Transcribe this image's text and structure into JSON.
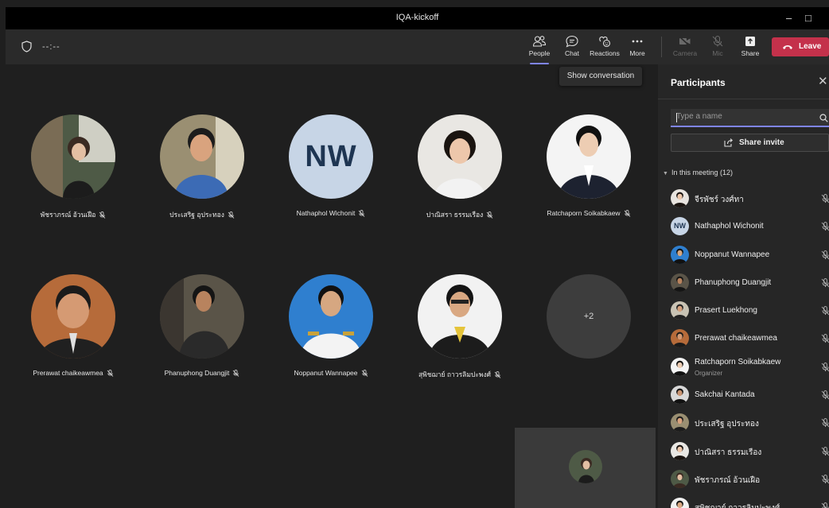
{
  "window": {
    "title": "IQA-kickoff",
    "minimize": "–",
    "maximize": "□"
  },
  "toolbar": {
    "timer": "--:--",
    "buttons": {
      "people": "People",
      "chat": "Chat",
      "reactions": "Reactions",
      "more": "More",
      "camera": "Camera",
      "mic": "Mic",
      "share": "Share",
      "leave": "Leave"
    }
  },
  "tooltip": "Show conversation",
  "stage": {
    "tiles": [
      {
        "name": "พัชราภรณ์ อ้วนเฝือ"
      },
      {
        "name": "ประเสริฐ อุประทอง"
      },
      {
        "name": "Nathaphol Wichonit",
        "initials": "NW"
      },
      {
        "name": "ปาณิสรา ธรรมเรือง"
      },
      {
        "name": "Ratchaporn Soikabkaew"
      },
      {
        "name": "Prerawat chaikeawmea"
      },
      {
        "name": "Phanuphong Duangjit"
      },
      {
        "name": "Noppanut Wannapee"
      },
      {
        "name": "สุพิชฌาย์ ถาวรลิมปะพงศ์"
      },
      {
        "overflow": "+2"
      }
    ]
  },
  "panel": {
    "title": "Participants",
    "close": "✕",
    "search_placeholder": "Type a name",
    "share_invite": "Share invite",
    "section": "In this meeting (12)",
    "participants": [
      {
        "name": "จีรพัชร์ วงศ์ทา"
      },
      {
        "name": "Nathaphol Wichonit",
        "initials": "NW"
      },
      {
        "name": "Noppanut Wannapee"
      },
      {
        "name": "Phanuphong Duangjit"
      },
      {
        "name": "Prasert Luekhong"
      },
      {
        "name": "Prerawat chaikeawmea"
      },
      {
        "name": "Ratchaporn Soikabkaew",
        "role": "Organizer"
      },
      {
        "name": "Sakchai Kantada"
      },
      {
        "name": "ประเสริฐ อุประทอง"
      },
      {
        "name": "ปาณิสรา ธรรมเรือง"
      },
      {
        "name": "พัชราภรณ์ อ้วนเฝือ"
      },
      {
        "name": "สุพิชฌาย์ ถาวรลิมปะพงศ์"
      }
    ]
  }
}
